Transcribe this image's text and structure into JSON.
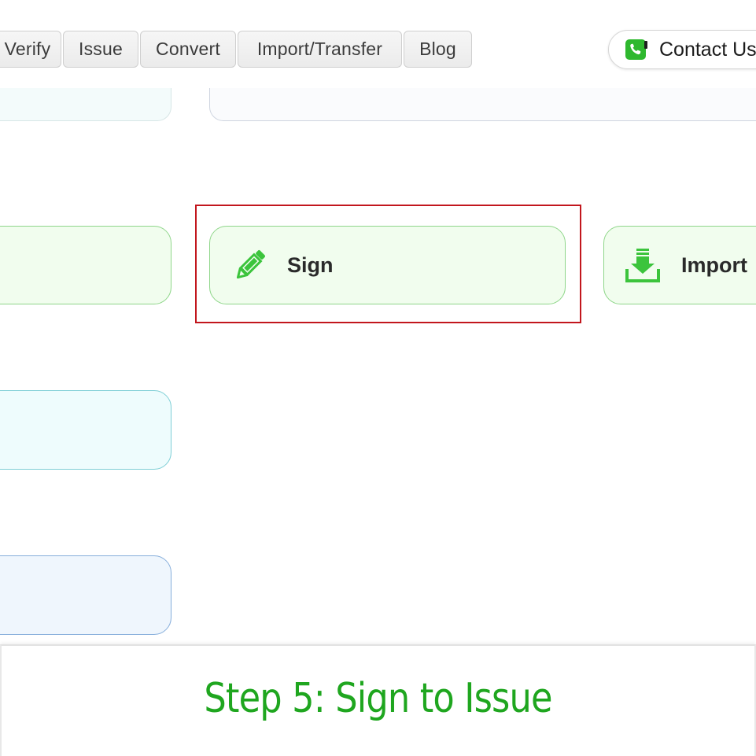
{
  "nav": {
    "items": [
      {
        "label": "Verify"
      },
      {
        "label": "Issue"
      },
      {
        "label": "Convert"
      },
      {
        "label": "Import/Transfer"
      },
      {
        "label": "Blog"
      }
    ],
    "contact": {
      "label": "Contact Us",
      "icon": "phone-icon",
      "icon_color": "#2eb82e"
    }
  },
  "actions": {
    "sign": {
      "label": "Sign",
      "icon": "pencil-icon",
      "icon_color": "#3cc43c"
    },
    "import": {
      "label": "Import",
      "icon": "download-tray-icon",
      "icon_color": "#3cc43c"
    }
  },
  "highlight": {
    "target": "sign",
    "color": "#c2161d"
  },
  "caption": {
    "text": "Step 5: Sign to Issue",
    "color": "#1fa61f"
  }
}
